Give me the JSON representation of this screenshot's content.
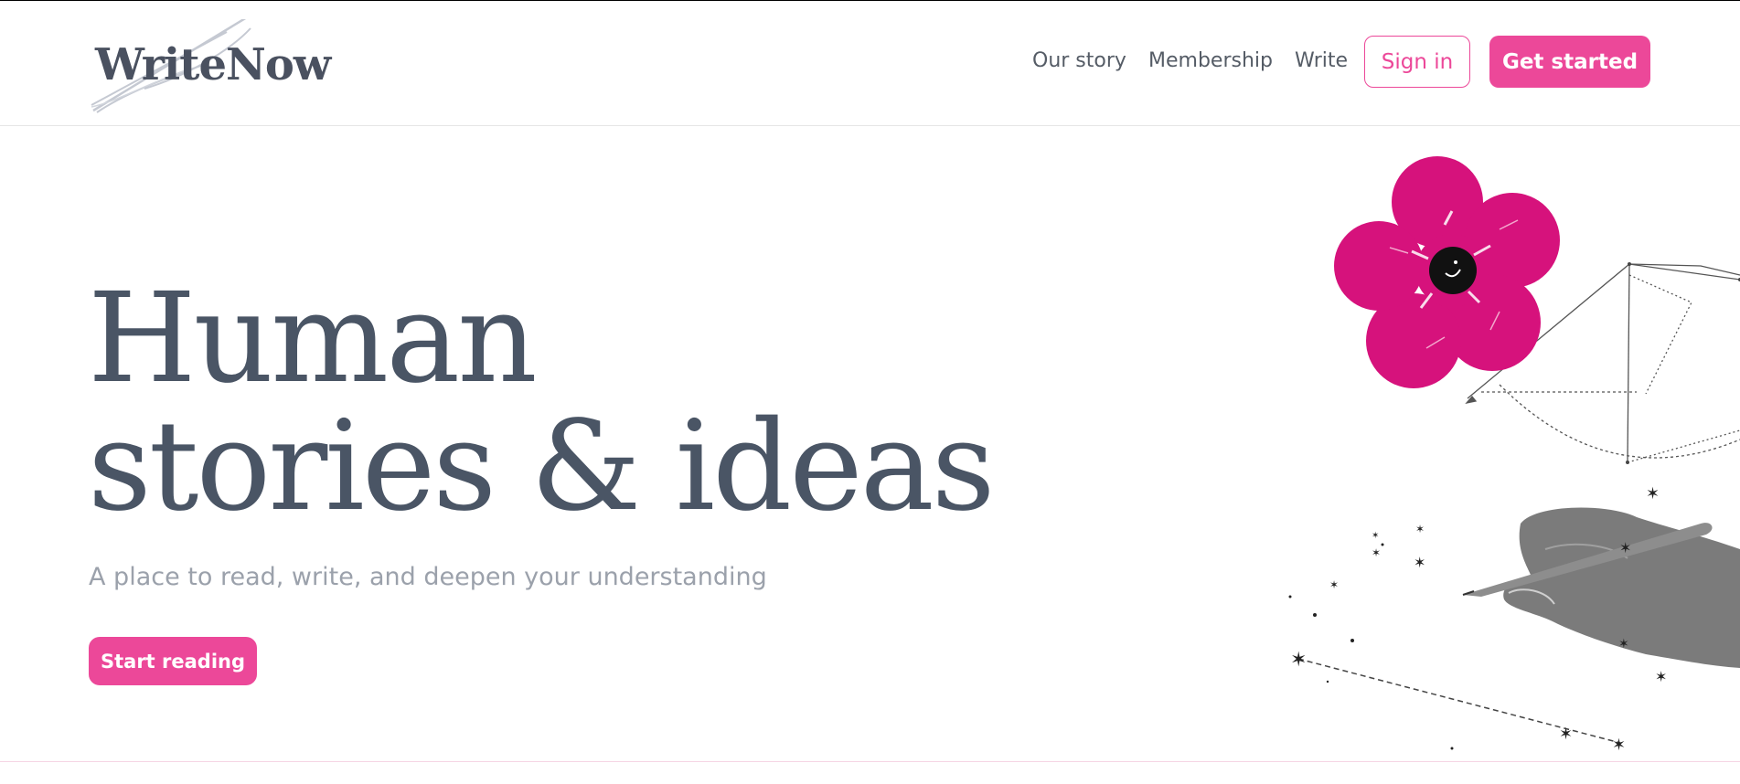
{
  "brand": {
    "name": "WriteNow"
  },
  "nav": {
    "links": [
      "Our story",
      "Membership",
      "Write"
    ],
    "sign_in": "Sign in",
    "get_started": "Get started"
  },
  "hero": {
    "title_line1": "Human",
    "title_line2": "stories & ideas",
    "subtitle": "A place to read, write, and deepen your understanding",
    "cta": "Start reading"
  },
  "illustration": {
    "elements": [
      "flower-icon",
      "geometry-diagram",
      "hand-with-pen-icon",
      "constellation-stars"
    ]
  },
  "colors": {
    "accent": "#ec4899",
    "heading": "#4a5565",
    "subtitle": "#9ba1ab",
    "nav_text": "#555c66",
    "flower": "#d6127c"
  }
}
